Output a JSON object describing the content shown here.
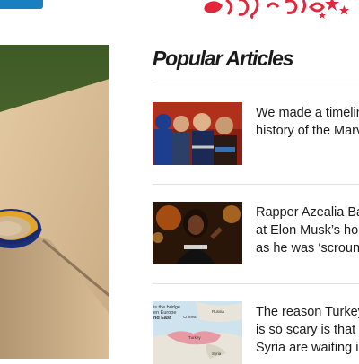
{
  "header": {
    "logo_icon": "brand-logo-icon",
    "logo_color": "#e2263b",
    "action_button_color": "#1a7fc1"
  },
  "hero": {
    "icon": "food-bowl-photo"
  },
  "popular": {
    "heading": "Popular Articles",
    "articles": [
      {
        "title": "We made a timeline\nhistory of the Marv",
        "thumb_icon": "superheroes-photo"
      },
      {
        "title": "Rapper Azealia Ba\nat Elon Musk’s ho\nas he was ‘scroun",
        "thumb_icon": "rapper-photo"
      },
      {
        "title": "The reason Turkey\nis so scary is that\nSyria are waiting i",
        "thumb_icon": "middle-east-map"
      }
    ],
    "map_labels": [
      "is the bridge",
      "en Europe",
      "nd East",
      "Crimea",
      "Russia",
      "Turkey",
      "Syria"
    ]
  }
}
